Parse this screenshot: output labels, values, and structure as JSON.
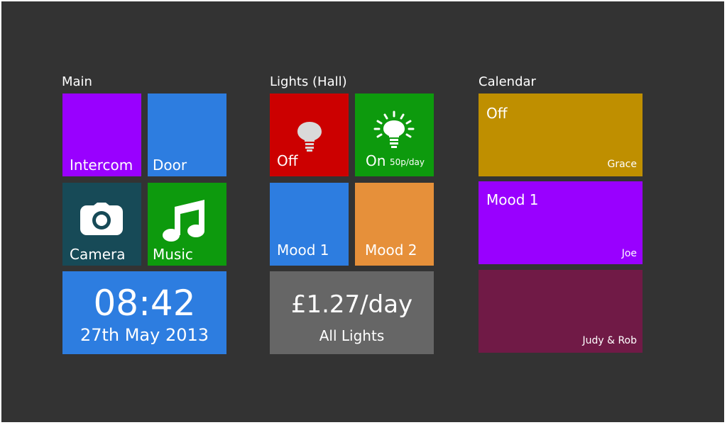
{
  "groups": {
    "main": {
      "title": "Main"
    },
    "lights": {
      "title": "Lights (Hall)"
    },
    "calendar": {
      "title": "Calendar"
    }
  },
  "main": {
    "intercom": {
      "label": "Intercom",
      "color": "#9900ff"
    },
    "door": {
      "label": "Door",
      "color": "#2d7de0"
    },
    "camera": {
      "label": "Camera",
      "color": "#174a57",
      "icon": "camera-icon"
    },
    "music": {
      "label": "Music",
      "color": "#0d9a0d",
      "icon": "music-note-icon"
    },
    "clock": {
      "time": "08:42",
      "date": "27th May 2013",
      "color": "#2d7de0"
    }
  },
  "lights": {
    "off": {
      "label": "Off",
      "color": "#cc0000",
      "icon": "bulb-off-icon"
    },
    "on": {
      "label": "On",
      "cost": "50p/day",
      "color": "#0d9a0d",
      "icon": "bulb-on-icon"
    },
    "mood1": {
      "label": "Mood 1",
      "color": "#2d7de0"
    },
    "mood2": {
      "label": "Mood 2",
      "color": "#e6903a"
    },
    "all": {
      "cost": "£1.27/day",
      "label": "All Lights",
      "color": "#666666"
    }
  },
  "calendar": {
    "entries": [
      {
        "status": "Off",
        "person": "Grace",
        "color": "#bf8f00"
      },
      {
        "status": "Mood 1",
        "person": "Joe",
        "color": "#9900ff"
      },
      {
        "status": "",
        "person": "Judy & Rob",
        "color": "#701a46"
      }
    ]
  }
}
